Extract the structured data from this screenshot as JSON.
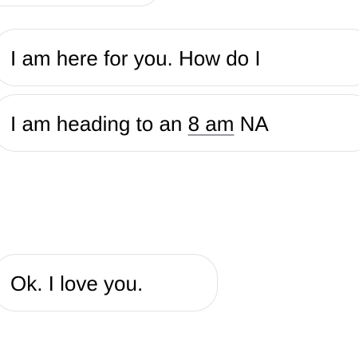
{
  "messages": [
    {
      "text": ""
    },
    {
      "text": "I am here for you. How do I"
    },
    {
      "text_before": "I am heading to an ",
      "link_text": "8 am",
      "text_after": " NA"
    },
    {
      "text": "Ok. I love you."
    }
  ],
  "colors": {
    "background": "#ffffff",
    "bubble_border": "#e3e3e6",
    "text": "#000000",
    "link_underline": "#9a9aa0"
  }
}
